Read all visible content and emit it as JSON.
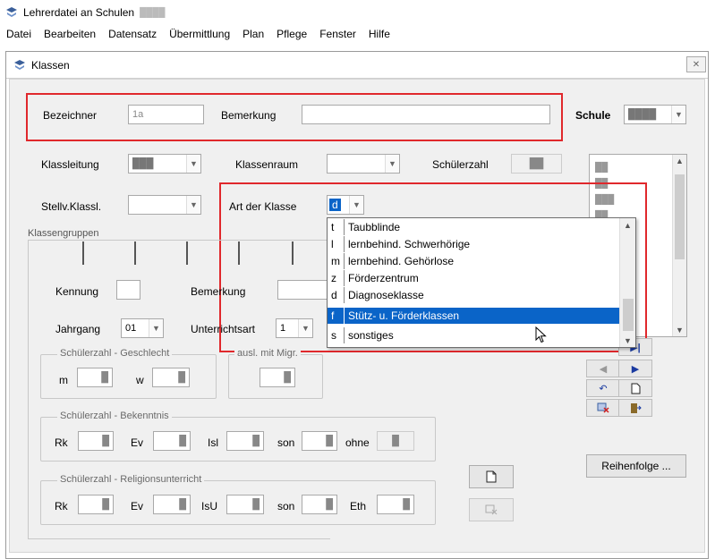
{
  "app": {
    "title": "Lehrerdatei an Schulen",
    "title_suffix": "████"
  },
  "menu": [
    "Datei",
    "Bearbeiten",
    "Datensatz",
    "Übermittlung",
    "Plan",
    "Pflege",
    "Fenster",
    "Hilfe"
  ],
  "window": {
    "title": "Klassen",
    "close_glyph": "✕"
  },
  "form": {
    "bezeichner": {
      "label": "Bezeichner",
      "value": "1a"
    },
    "bemerkung": {
      "label": "Bemerkung",
      "value": ""
    },
    "schule": {
      "label": "Schule",
      "value": "████"
    },
    "klassleitung": {
      "label": "Klassleitung",
      "value": "███"
    },
    "klassenraum": {
      "label": "Klassenraum",
      "value": ""
    },
    "schuelerzahl": {
      "label": "Schülerzahl",
      "value": "██"
    },
    "stellv": {
      "label": "Stellv.Klassl.",
      "value": ""
    },
    "art": {
      "label": "Art der Klasse",
      "value": "d"
    },
    "klassengruppen": {
      "label": "Klassengruppen"
    },
    "kennung": {
      "label": "Kennung",
      "value": ""
    },
    "bemerkung2": {
      "label": "Bemerkung",
      "value": ""
    },
    "jahrgang": {
      "label": "Jahrgang",
      "value": "01"
    },
    "unterrichtsart": {
      "label": "Unterrichtsart",
      "value": "1"
    },
    "geschlecht": {
      "title": "Schülerzahl - Geschlecht",
      "m_label": "m",
      "m_value": "█",
      "w_label": "w",
      "w_value": "█"
    },
    "migr": {
      "title": "ausl. mit Migr.",
      "value": "█"
    },
    "bekenntnis": {
      "title": "Schülerzahl - Bekenntnis",
      "rk": "Rk",
      "rk_value": "█",
      "ev": "Ev",
      "ev_value": "█",
      "isl": "Isl",
      "isl_value": "█",
      "son": "son",
      "son_value": "█",
      "ohne": "ohne",
      "ohne_value": "█"
    },
    "religion": {
      "title": "Schülerzahl - Religionsunterricht",
      "rk": "Rk",
      "rk_value": "█",
      "ev": "Ev",
      "ev_value": "█",
      "isu": "IsU",
      "isu_value": "█",
      "son": "son",
      "son_value": "█",
      "eth": "Eth",
      "eth_value": "█"
    },
    "reihenfolge": "Reihenfolge ..."
  },
  "classlist": [
    "██",
    "██",
    "███",
    "██"
  ],
  "dropdown": {
    "selected": "f",
    "options": [
      {
        "code": "t",
        "label": "Taubblinde"
      },
      {
        "code": "l",
        "label": "lernbehind. Schwerhörige"
      },
      {
        "code": "m",
        "label": "lernbehind. Gehörlose"
      },
      {
        "code": "z",
        "label": "Förderzentrum"
      },
      {
        "code": "d",
        "label": "Diagnoseklasse"
      },
      {
        "code": "f",
        "label": "Stütz- u. Förderklassen"
      },
      {
        "code": "s",
        "label": "sonstiges"
      }
    ]
  },
  "colors": {
    "highlight": "#e0282c",
    "selection": "#0a64c8"
  }
}
